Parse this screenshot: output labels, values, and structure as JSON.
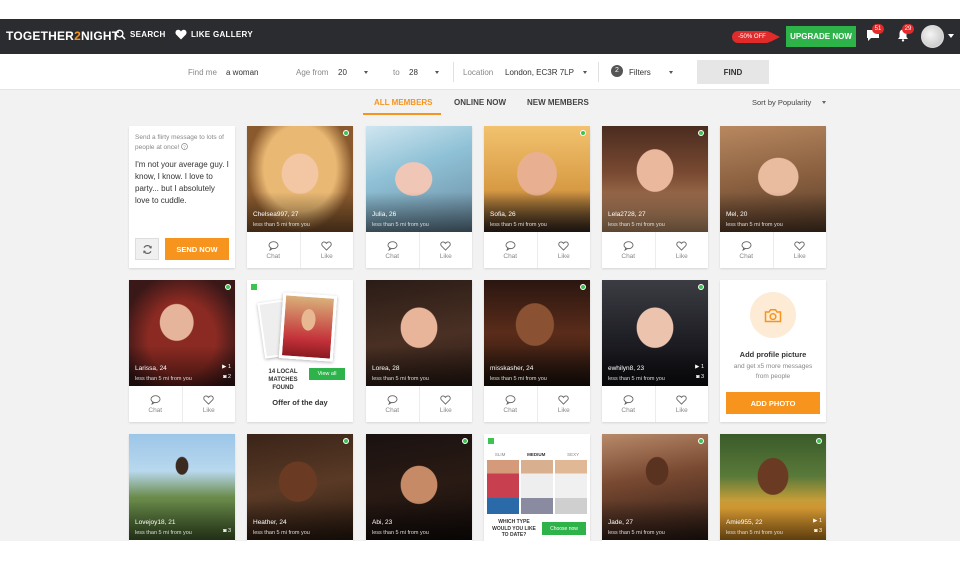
{
  "nav": {
    "logo_a": "TOGETHER",
    "logo_b": "2",
    "logo_c": "NIGHT",
    "search": "SEARCH",
    "like_gallery": "LIKE GALLERY",
    "discount": "-50% OFF",
    "upgrade": "UPGRADE NOW",
    "messages_count": "51",
    "notifications_count": "29",
    "accent": "#f7941d",
    "upgrade_color": "#2db34a"
  },
  "filters": {
    "find_me_label": "Find me",
    "find_me_value": "a woman",
    "age_from_label": "Age from",
    "age_from_value": "20",
    "age_to_label": "to",
    "age_to_value": "28",
    "location_label": "Location",
    "location_value": "London, EC3R 7LP",
    "filters_count": "2",
    "filters_label": "Filters",
    "find_button": "FIND"
  },
  "tabs": {
    "items": [
      "ALL MEMBERS",
      "ONLINE NOW",
      "NEW MEMBERS"
    ],
    "active": "ALL MEMBERS",
    "sort": "Sort by Popularity"
  },
  "message_card": {
    "title": "Send a flirty message to lots of people at once!",
    "body": "I'm not your average guy. I know, I know. I love to party... but I absolutely love to cuddle.",
    "send": "SEND NOW"
  },
  "actions": {
    "chat": "Chat",
    "like": "Like"
  },
  "profiles": [
    {
      "name": "Chelsea997, 27",
      "distance": "less than 5 mi from you"
    },
    {
      "name": "Julia, 26",
      "distance": "less than 5 mi from you"
    },
    {
      "name": "Sofia, 26",
      "distance": "less than 5 mi from you"
    },
    {
      "name": "Lela2728, 27",
      "distance": "less than 5 mi from you"
    },
    {
      "name": "Mel, 20",
      "distance": "less than 5 mi from you"
    },
    {
      "name": "Larissa, 24",
      "distance": "less than 5 mi from you",
      "count_a": "1",
      "count_b": "2"
    },
    {
      "name": "Lorea, 28",
      "distance": "less than 5 mi from you"
    },
    {
      "name": "misskasher, 24",
      "distance": "less than 5 mi from you"
    },
    {
      "name": "ewhilyn8, 23",
      "distance": "less than 5 mi from you",
      "count_a": "1",
      "count_b": "3"
    },
    {
      "name": "Lovejoy18, 21",
      "distance": "less than 5 mi from you",
      "count_a": "3"
    },
    {
      "name": "Heather, 24",
      "distance": "less than 5 mi from you"
    },
    {
      "name": "Abi, 23",
      "distance": "less than 5 mi from you"
    },
    {
      "name": "Jade, 27",
      "distance": "less than 5 mi from you"
    },
    {
      "name": "Amie955, 22",
      "distance": "less than 5 mi from you",
      "count_a": "1",
      "count_b": "3"
    }
  ],
  "offer": {
    "matches": "14 LOCAL MATCHES FOUND",
    "view_all": "View all",
    "title": "Offer of the day"
  },
  "add_photo": {
    "title": "Add profile picture",
    "subtitle": "and get x5 more messages from people",
    "button": "ADD PHOTO"
  },
  "body_type": {
    "options": [
      "SLIM",
      "MEDIUM",
      "SEXY"
    ],
    "selected": "MEDIUM",
    "question": "WHICH TYPE WOULD YOU LIKE TO DATE?",
    "button": "Choose now"
  }
}
